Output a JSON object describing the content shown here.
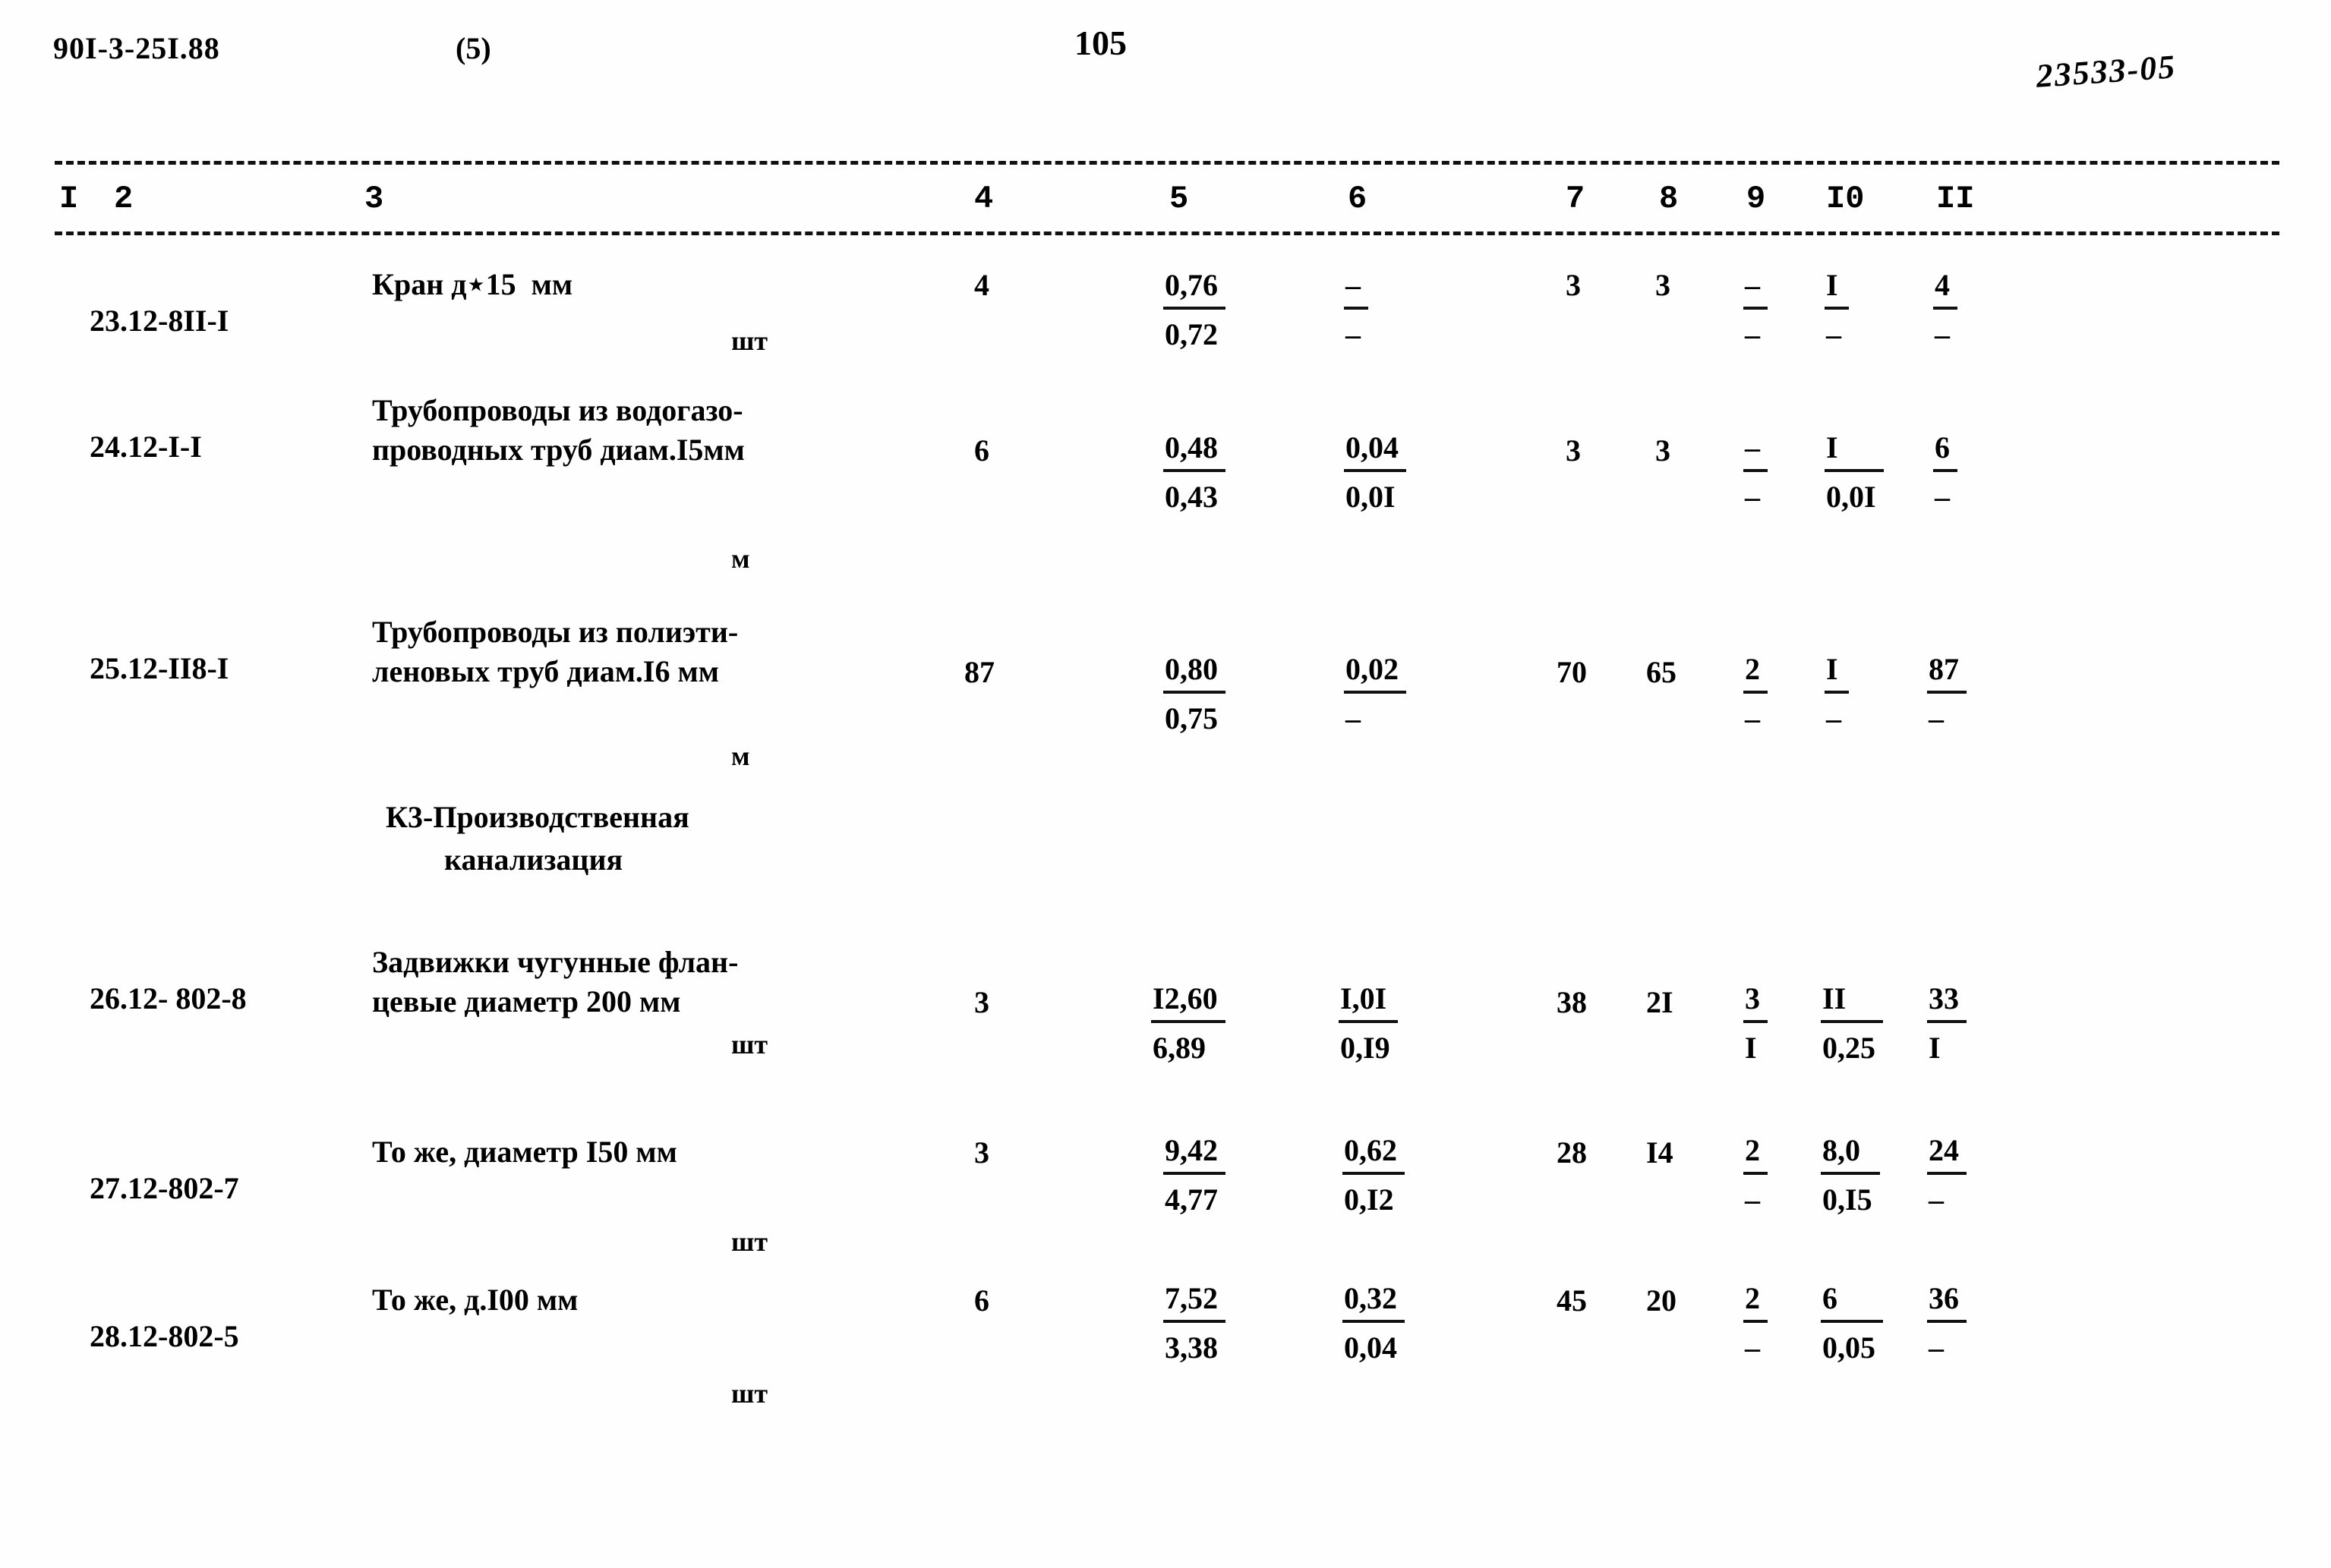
{
  "header": {
    "doc_code": "90I-3-25I.88",
    "variant": "(5)",
    "page_number": "105",
    "hand_annotation": "23533-05"
  },
  "table": {
    "column_headers": [
      "I",
      "2",
      "3",
      "4",
      "5",
      "6",
      "7",
      "8",
      "9",
      "I0",
      "II"
    ],
    "rows": [
      {
        "no": "23.",
        "code": "12-8II-I",
        "desc_line1": "Кран д⋆15  мм",
        "desc_line2": "",
        "unit": "шт",
        "c4": "4",
        "c5_top": "0,76",
        "c5_bot": "0,72",
        "c6_top": "–",
        "c6_bot": "–",
        "c7": "3",
        "c8": "3",
        "c9_top": "–",
        "c9_bot": "–",
        "c10_top": "I",
        "c10_bot": "–",
        "c11_top": "4",
        "c11_bot": "–"
      },
      {
        "no": "24.",
        "code": "12-I-I",
        "desc_line1": "Трубопроводы из водогазо-",
        "desc_line2": "проводных труб диам.I5мм",
        "unit": "м",
        "c4": "6",
        "c5_top": "0,48",
        "c5_bot": "0,43",
        "c6_top": "0,04",
        "c6_bot": "0,0I",
        "c7": "3",
        "c8": "3",
        "c9_top": "–",
        "c9_bot": "–",
        "c10_top": "I",
        "c10_bot": "0,0I",
        "c11_top": "6",
        "c11_bot": "–"
      },
      {
        "no": "25.",
        "code": "12-II8-I",
        "desc_line1": "Трубопроводы из полиэти-",
        "desc_line2": "леновых труб диам.I6 мм",
        "unit": "м",
        "c4": "87",
        "c5_top": "0,80",
        "c5_bot": "0,75",
        "c6_top": "0,02",
        "c6_bot": "–",
        "c7": "70",
        "c8": "65",
        "c9_top": "2",
        "c9_bot": "–",
        "c10_top": "I",
        "c10_bot": "–",
        "c11_top": "87",
        "c11_bot": "–"
      },
      {
        "no": "26.",
        "code": "12- 802-8",
        "desc_line1": "Задвижки чугунные флан-",
        "desc_line2": "цевые диаметр 200 мм",
        "unit": "шт",
        "c4": "3",
        "c5_top": "I2,60",
        "c5_bot": "6,89",
        "c6_top": "I,0I",
        "c6_bot": "0,I9",
        "c7": "38",
        "c8": "2I",
        "c9_top": "3",
        "c9_bot": "I",
        "c10_top": "II",
        "c10_bot": "0,25",
        "c11_top": "33",
        "c11_bot": "I"
      },
      {
        "no": "27.",
        "code": "12-802-7",
        "desc_line1": "То же, диаметр I50 мм",
        "desc_line2": "",
        "unit": "шт",
        "c4": "3",
        "c5_top": "9,42",
        "c5_bot": "4,77",
        "c6_top": "0,62",
        "c6_bot": "0,I2",
        "c7": "28",
        "c8": "I4",
        "c9_top": "2",
        "c9_bot": "–",
        "c10_top": "8,0",
        "c10_bot": "0,I5",
        "c11_top": "24",
        "c11_bot": "–"
      },
      {
        "no": "28.",
        "code": "12-802-5",
        "desc_line1": "То же, д.I00 мм",
        "desc_line2": "",
        "unit": "шт",
        "c4": "6",
        "c5_top": "7,52",
        "c5_bot": "3,38",
        "c6_top": "0,32",
        "c6_bot": "0,04",
        "c7": "45",
        "c8": "20",
        "c9_top": "2",
        "c9_bot": "–",
        "c10_top": "6",
        "c10_bot": "0,05",
        "c11_top": "36",
        "c11_bot": "–"
      }
    ],
    "section_title_line1": "К3-Производственная",
    "section_title_line2": "канализация"
  }
}
